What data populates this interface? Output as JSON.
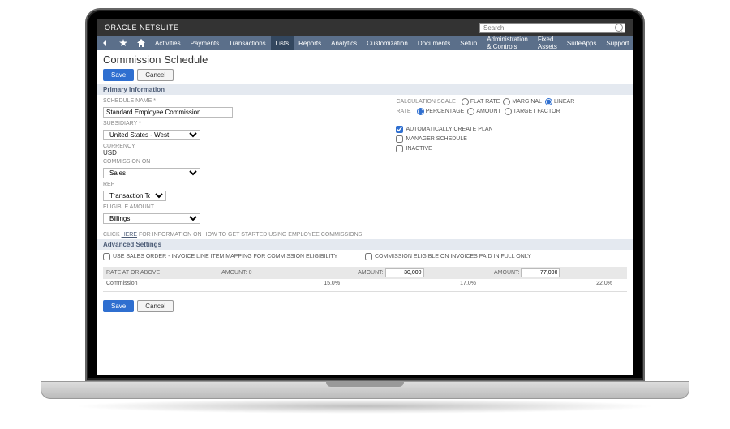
{
  "brand": {
    "left": "ORACLE",
    "right": "NETSUITE"
  },
  "search": {
    "placeholder": "Search"
  },
  "menu": [
    "Activities",
    "Payments",
    "Transactions",
    "Lists",
    "Reports",
    "Analytics",
    "Customization",
    "Documents",
    "Setup",
    "Administration & Controls",
    "Fixed Assets",
    "SuiteApps",
    "Support"
  ],
  "menu_active_index": 3,
  "page_title": "Commission Schedule",
  "buttons": {
    "save": "Save",
    "cancel": "Cancel"
  },
  "sections": {
    "primary": "Primary Information",
    "advanced": "Advanced Settings"
  },
  "fields": {
    "schedule_name": {
      "label": "SCHEDULE NAME",
      "value": "Standard Employee Commission"
    },
    "subsidiary": {
      "label": "SUBSIDIARY",
      "value": "United States - West"
    },
    "currency": {
      "label": "CURRENCY",
      "value": "USD"
    },
    "commission_on": {
      "label": "COMMISSION ON",
      "value": "Sales"
    },
    "rep": {
      "label": "REP",
      "value": "Transaction Total"
    },
    "eligible": {
      "label": "ELIGIBLE AMOUNT",
      "value": "Billings"
    }
  },
  "help_text_pre": "CLICK ",
  "help_link": "HERE",
  "help_text_post": " FOR INFORMATION ON HOW TO GET STARTED USING EMPLOYEE COMMISSIONS.",
  "calc_scale": {
    "label": "CALCULATION SCALE",
    "options": [
      "FLAT RATE",
      "MARGINAL",
      "LINEAR"
    ],
    "selected": 2
  },
  "rate": {
    "label": "RATE",
    "options": [
      "PERCENTAGE",
      "AMOUNT",
      "TARGET FACTOR"
    ],
    "selected": 0
  },
  "checks": {
    "auto_plan": {
      "label": "AUTOMATICALLY CREATE PLAN",
      "checked": true
    },
    "mgr_sched": {
      "label": "MANAGER SCHEDULE",
      "checked": false
    },
    "inactive": {
      "label": "INACTIVE",
      "checked": false
    }
  },
  "advanced": {
    "use_sales_order": {
      "label": "USE SALES ORDER - INVOICE LINE ITEM MAPPING FOR COMMISSION ELIGIBILITY",
      "checked": false
    },
    "paid_in_full": {
      "label": "COMMISSION ELIGIBLE ON INVOICES PAID IN FULL ONLY",
      "checked": false
    }
  },
  "tiers": {
    "row_label_hdr": "RATE AT OR ABOVE",
    "amount_hdr": "AMOUNT:",
    "amounts": [
      "0",
      "30,000",
      "77,000"
    ],
    "row_label": "Commission",
    "rates": [
      "15.0%",
      "17.0%",
      "22.0%"
    ]
  }
}
